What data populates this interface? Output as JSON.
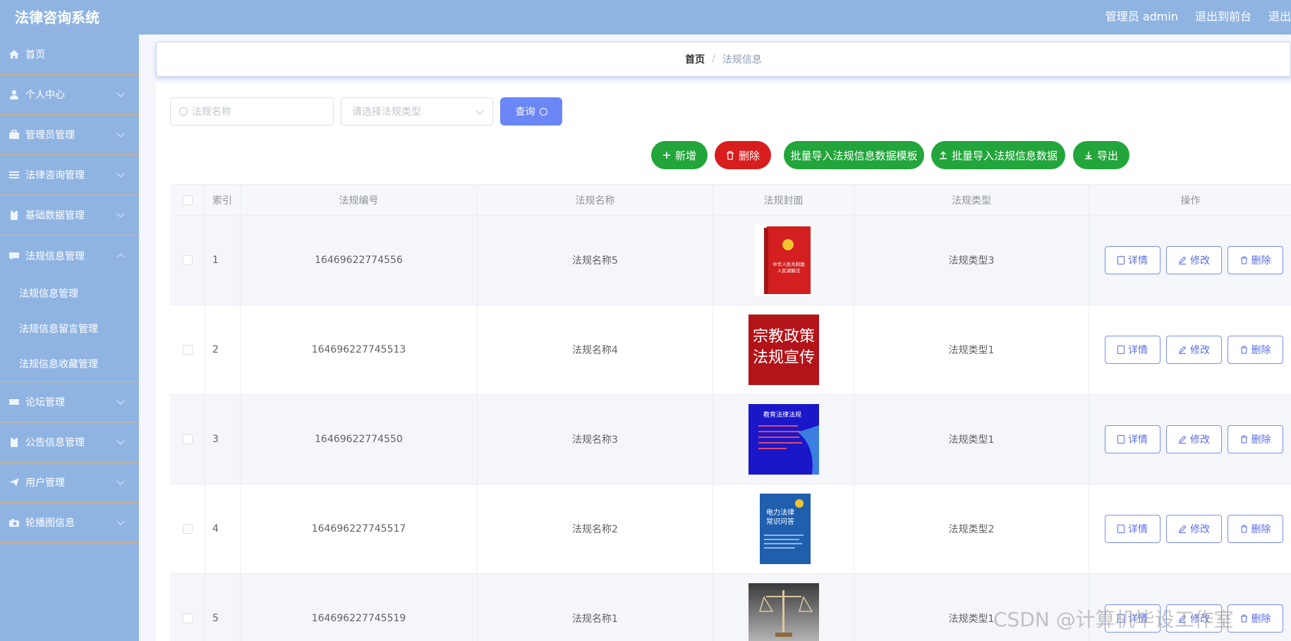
{
  "header": {
    "app_title": "法律咨询系统",
    "admin_label": "管理员 admin",
    "to_front_label": "退出到前台",
    "logout_label": "退出"
  },
  "sidebar": {
    "items": [
      {
        "label": "首页",
        "icon": "home-icon",
        "expandable": false
      },
      {
        "label": "个人中心",
        "icon": "user-icon",
        "expandable": true
      },
      {
        "label": "管理员管理",
        "icon": "briefcase-icon",
        "expandable": true
      },
      {
        "label": "法律咨询管理",
        "icon": "list-icon",
        "expandable": true
      },
      {
        "label": "基础数据管理",
        "icon": "clipboard-icon",
        "expandable": true
      },
      {
        "label": "法规信息管理",
        "icon": "chat-icon",
        "expandable": true,
        "expanded": true,
        "children": [
          "法规信息管理",
          "法规信息留言管理",
          "法规信息收藏管理"
        ]
      },
      {
        "label": "论坛管理",
        "icon": "ticket-icon",
        "expandable": true
      },
      {
        "label": "公告信息管理",
        "icon": "clipboard-icon",
        "expandable": true
      },
      {
        "label": "用户管理",
        "icon": "send-icon",
        "expandable": true
      },
      {
        "label": "轮播图信息",
        "icon": "camera-icon",
        "expandable": true
      }
    ]
  },
  "breadcrumb": {
    "home": "首页",
    "separator": "/",
    "current": "法规信息"
  },
  "search": {
    "name_placeholder": "法规名称",
    "type_placeholder": "请选择法规类型",
    "query_label": "查询"
  },
  "actions": {
    "add": "新增",
    "delete": "删除",
    "import_template": "批量导入法规信息数据模板",
    "import_data": "批量导入法规信息数据",
    "export": "导出"
  },
  "table": {
    "headers": [
      "索引",
      "法规编号",
      "法规名称",
      "法规封面",
      "法规类型",
      "操作"
    ],
    "rows": [
      {
        "index": "1",
        "code": "16469622774556",
        "name": "法规名称5",
        "type": "法规类型3",
        "cover": "red-book-constitution"
      },
      {
        "index": "2",
        "code": "164696227745513",
        "name": "法规名称4",
        "type": "法规类型1",
        "cover": "red-poster-religion"
      },
      {
        "index": "3",
        "code": "16469622774550",
        "name": "法规名称3",
        "type": "法规类型1",
        "cover": "blue-education-slide"
      },
      {
        "index": "4",
        "code": "164696227745517",
        "name": "法规名称2",
        "type": "法规类型2",
        "cover": "blue-power-law-book"
      },
      {
        "index": "5",
        "code": "164696227745519",
        "name": "法规名称1",
        "type": "法规类型1",
        "cover": "scales-photo"
      }
    ],
    "op_labels": {
      "detail": "详情",
      "edit": "修改",
      "delete": "删除"
    }
  },
  "covers": {
    "row1_top": "中华人民共和国",
    "row1_bottom": "人民调解法",
    "row2_line1": "宗教政策",
    "row2_line2": "法规宣传",
    "row3_title": "教育法律法规",
    "row4_line1": "电力法律",
    "row4_line2": "常识问答"
  },
  "watermark": "CSDN @计算机毕设工作室",
  "colors": {
    "topbar": "#90b4e2",
    "sidebar": "#90b4e2",
    "primary": "#6b86f5",
    "success": "#22a53a",
    "danger": "#d71d1d"
  }
}
